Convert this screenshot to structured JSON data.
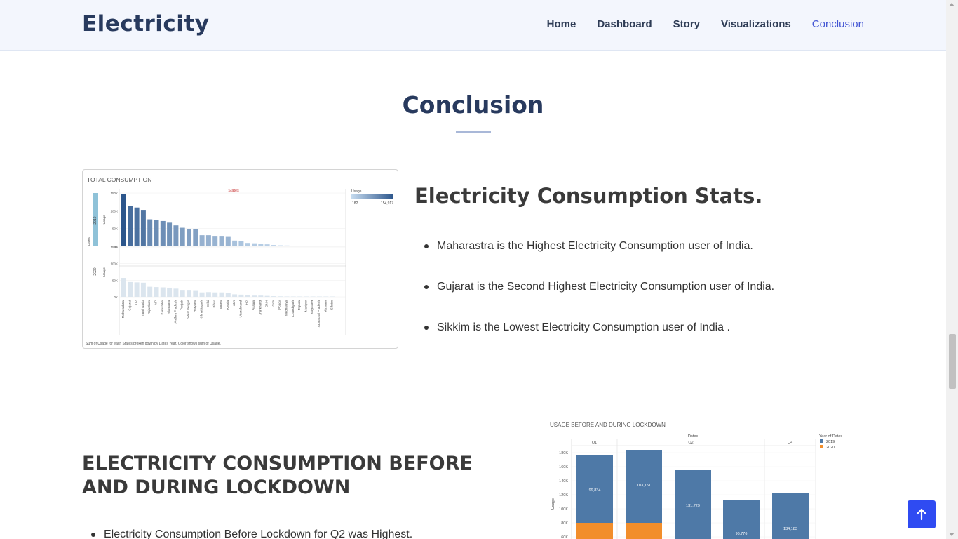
{
  "header": {
    "logo": "Electricity",
    "nav": [
      {
        "label": "Home"
      },
      {
        "label": "Dashboard"
      },
      {
        "label": "Story"
      },
      {
        "label": "Visualizations"
      },
      {
        "label": "Conclusion",
        "active": true
      }
    ]
  },
  "section": {
    "title": "Conclusion"
  },
  "stats": {
    "heading": "Electricity Consumption Stats.",
    "points": [
      "Maharastra is the Highest Electricity Consumption user of India.",
      "Gujarat is the Second Highest Electricity Consumption user of India.",
      "Sikkim is the Lowest Electricity Consumption user of India ."
    ]
  },
  "lockdown": {
    "heading": "ELECTRICITY CONSUMPTION BEFORE AND DURING LOCKDOWN",
    "points": [
      "Electricity Consumption Before Lockdown for Q2 was Highest."
    ]
  },
  "colors": {
    "accent": "#4154d3",
    "title": "#283a5e",
    "button": "#2f4bf2",
    "bar_2019": "#4e79a7",
    "bar_2020": "#f28e2b"
  },
  "chart_data": [
    {
      "type": "bar",
      "title": "TOTAL CONSUMPTION",
      "column_header": "States",
      "row_header": "Dates",
      "ylabel": "Usage",
      "legend": {
        "title": "Usage",
        "min_label": "182",
        "max_label": "154,917"
      },
      "ticks": [
        "150K",
        "100K",
        "50K",
        "0K"
      ],
      "rows": [
        "2019",
        "2020"
      ],
      "caption": "Sum of Usage for each States broken down by Dates Year.  Color shows sum of Usage.",
      "categories": [
        "Maharashtra",
        "Gujarat",
        "UP",
        "Tamil Nadu",
        "Rajasthan",
        "MP",
        "Karnataka",
        "Telangana",
        "Andhra Pradesh",
        "Punjab",
        "West Bengal",
        "Haryana",
        "Chhattisgarh",
        "Delhi",
        "Bihar",
        "Odisha",
        "Kerala",
        "J&K",
        "Uttarakhand",
        "HP",
        "Assam",
        "Jharkhand",
        "DNH",
        "Goa",
        "Pondy",
        "Meghalaya",
        "Chandigarh",
        "Tripura",
        "Manipur",
        "Nagaland",
        "Arunachal Pradesh",
        "Mizoram",
        "Sikkim"
      ],
      "series": [
        {
          "name": "2019",
          "values": [
            154917,
            120000,
            115000,
            108000,
            80000,
            78000,
            75000,
            70000,
            62000,
            55000,
            52000,
            52000,
            33000,
            33000,
            31000,
            31000,
            30000,
            17000,
            15000,
            10000,
            9000,
            8000,
            6000,
            4000,
            3000,
            2500,
            2000,
            1800,
            1500,
            1200,
            1000,
            800,
            182
          ]
        },
        {
          "name": "2020",
          "values": [
            60000,
            47000,
            46000,
            45000,
            32000,
            31000,
            30000,
            29000,
            26000,
            22000,
            22000,
            21000,
            14000,
            15000,
            14000,
            14000,
            13000,
            8000,
            7000,
            5000,
            4000,
            4000,
            3000,
            2000,
            1500,
            1200,
            1000,
            800,
            700,
            600,
            500,
            400,
            150
          ]
        }
      ]
    },
    {
      "type": "bar",
      "title": "USAGE BEFORE AND DURING LOCKDOWN",
      "column_header": "Dates",
      "ylabel": "Usage",
      "legend": {
        "title": "Year of Dates",
        "entries": [
          "2019",
          "2020"
        ]
      },
      "ticks": [
        "180K",
        "160K",
        "140K",
        "120K",
        "100K",
        "80K",
        "60K"
      ],
      "groups": [
        "Q1",
        "Q2",
        "Q4"
      ],
      "bar_labels": [
        "99,834",
        "103,151",
        "131,729",
        "96,776",
        "134,183"
      ],
      "total_heights": [
        177000,
        184000,
        156000,
        113000,
        123000
      ],
      "orange_heights": [
        80000,
        80000,
        0,
        0,
        0
      ]
    }
  ]
}
